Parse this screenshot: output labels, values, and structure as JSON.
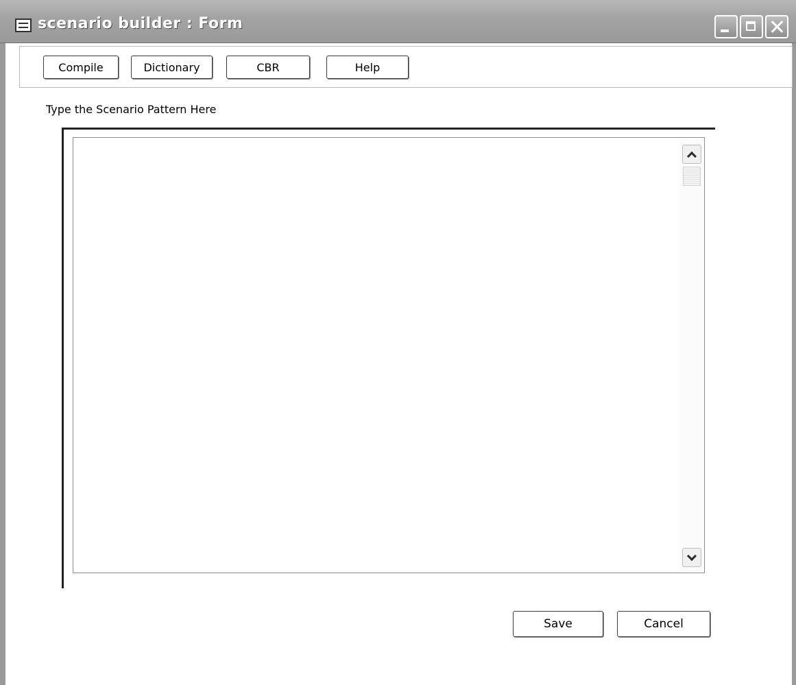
{
  "window": {
    "title": "scenario builder : Form",
    "icon": "form-icon",
    "controls": [
      "minimize-icon",
      "maximize-icon",
      "close-icon"
    ]
  },
  "toolbar": {
    "compile_label": "Compile",
    "dictionary_label": "Dictionary",
    "cbr_label": "CBR",
    "help_label": "Help"
  },
  "editor": {
    "label": "Type the Scenario Pattern Here",
    "value": ""
  },
  "actions": {
    "save_label": "Save",
    "cancel_label": "Cancel"
  }
}
